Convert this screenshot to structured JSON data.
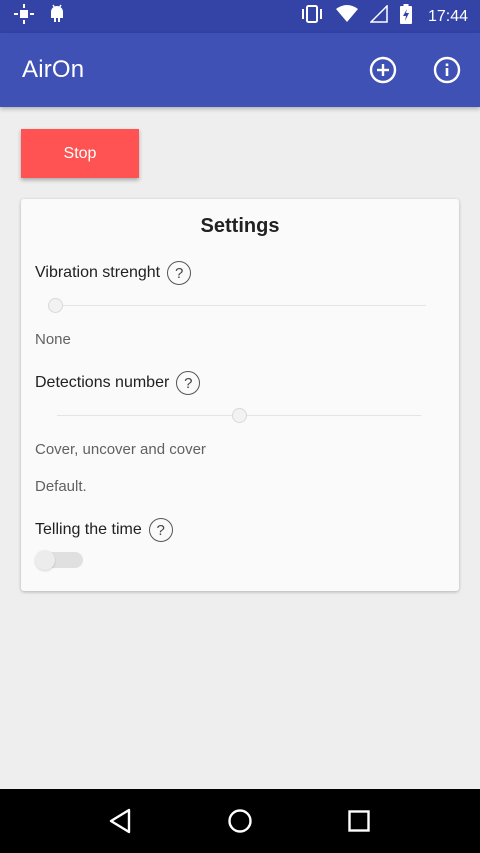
{
  "status_bar": {
    "time": "17:44",
    "icons": [
      "brightness-icon",
      "android-icon",
      "vibrate-icon",
      "wifi-icon",
      "signal-icon",
      "battery-charging-icon"
    ]
  },
  "app_bar": {
    "title": "AirOn",
    "actions": [
      "add-circle-icon",
      "info-icon"
    ]
  },
  "stop_button": {
    "label": "Stop",
    "color": "#ff5252"
  },
  "settings": {
    "title": "Settings",
    "vibration": {
      "label": "Vibration strenght",
      "help": "?",
      "slider_value": 0,
      "value_text": "None"
    },
    "detections": {
      "label": "Detections number",
      "help": "?",
      "slider_value": 0.5,
      "value_text": "Cover, uncover and cover",
      "note": "Default."
    },
    "telling_time": {
      "label": "Telling the time",
      "help": "?",
      "enabled": false
    }
  },
  "colors": {
    "primary": "#3f51b5",
    "primary_dark": "#3343a6",
    "accent_stop": "#ff5252"
  }
}
